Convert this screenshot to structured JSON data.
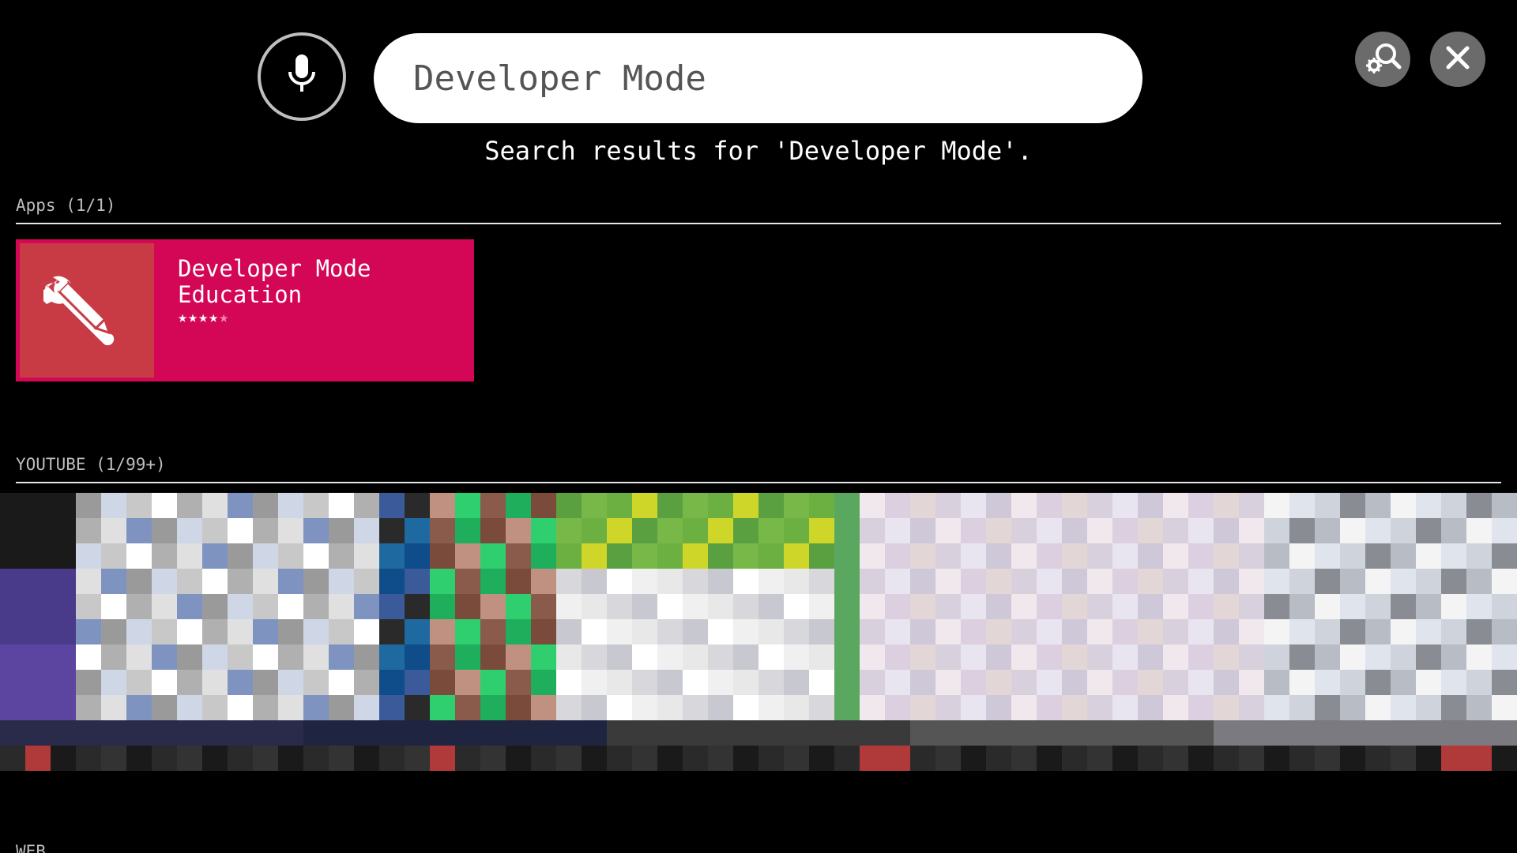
{
  "search": {
    "query": "Developer Mode",
    "caption": "Search results for 'Developer Mode'."
  },
  "icons": {
    "mic": "microphone-icon",
    "search_settings": "search-settings-icon",
    "close": "close-icon",
    "app": "wrench-pencil-icon"
  },
  "sections": {
    "apps": "Apps (1/1)",
    "youtube": "YOUTUBE (1/99+)",
    "web": "WEB"
  },
  "app_result": {
    "name": "Developer Mode",
    "category": "Education",
    "rating": 4,
    "rating_max": 5
  },
  "colors": {
    "tile_bg": "#d40656",
    "icon_bg": "#c83b44",
    "button_gray": "#6b6b6b"
  }
}
